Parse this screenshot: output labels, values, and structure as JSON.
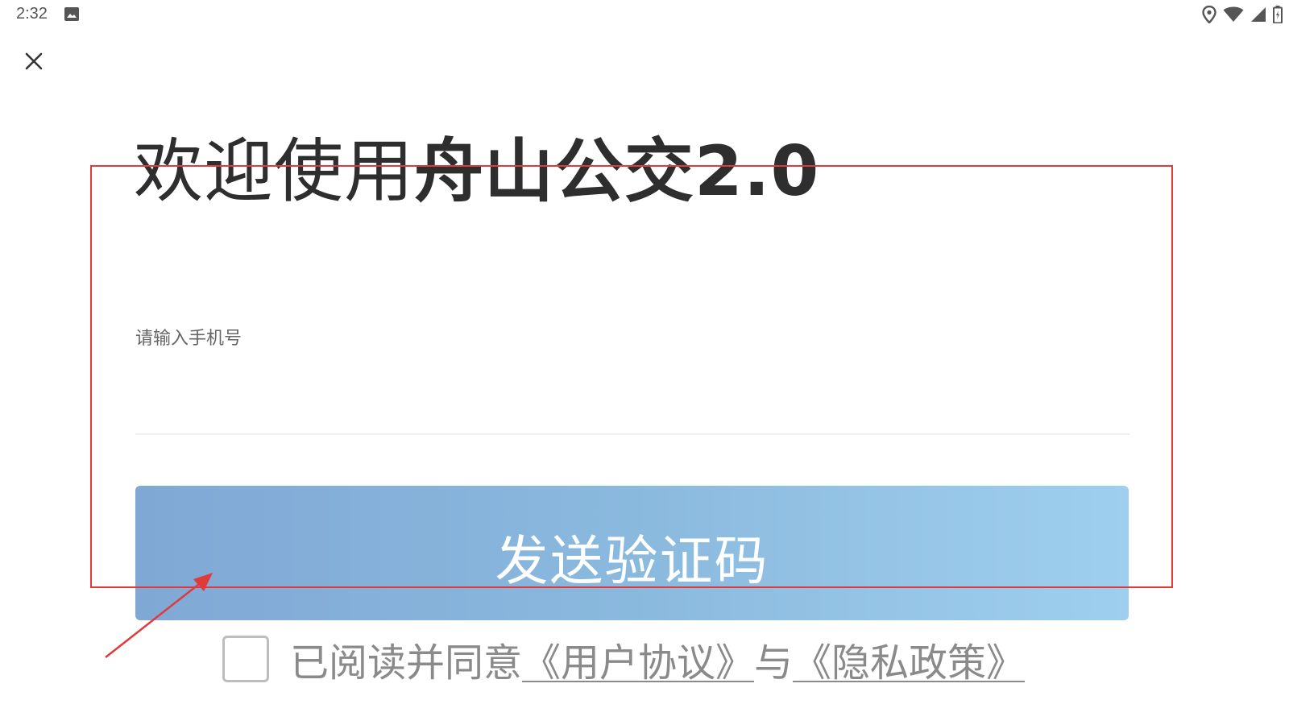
{
  "status_bar": {
    "time": "2:32",
    "left_icons": [
      "image-icon"
    ],
    "right_icons": [
      "location-icon",
      "wifi-icon",
      "signal-icon",
      "battery-icon"
    ]
  },
  "header": {
    "close_icon": "close-icon"
  },
  "welcome": {
    "title_prefix": "欢迎使用",
    "title_app": "舟山公交2.0"
  },
  "phone": {
    "label": "请输入手机号",
    "value": "",
    "placeholder": ""
  },
  "send_code": {
    "label": "发送验证码"
  },
  "agreement": {
    "checked": false,
    "text_prefix": "已阅读并同意",
    "user_agreement": "《用户协议》",
    "connector": "与",
    "privacy_policy": "《隐私政策》"
  },
  "colors": {
    "button_gradient_start": "#80a8d5",
    "button_gradient_end": "#9fcfee",
    "annotation": "#e03a3a",
    "title": "#2e2e2e"
  }
}
